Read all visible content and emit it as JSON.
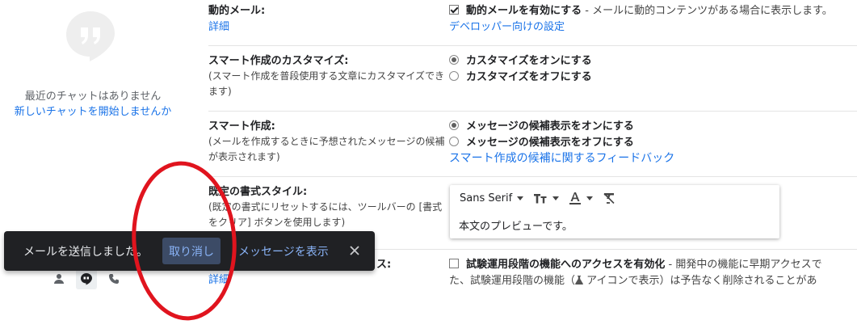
{
  "chat": {
    "empty_text": "最近のチャットはありません",
    "start_link": "新しいチャットを開始しませんか"
  },
  "settings": {
    "dynamic_mail": {
      "title": "動的メール:",
      "link": "詳細",
      "option_bold": "動的メールを有効にする",
      "option_desc": " - メールに動的コンテンツがある場合に表示します。",
      "option_link": "デベロッパー向けの設定",
      "checked": true
    },
    "smart_compose_personalize": {
      "title": "スマート作成のカスタマイズ:",
      "sub": "(スマート作成を普段使用する文章にカスタマイズできます)",
      "option_on": "カスタマイズをオンにする",
      "option_off": "カスタマイズをオフにする",
      "selected": "on"
    },
    "smart_compose": {
      "title": "スマート作成:",
      "sub": "(メールを作成するときに予想されたメッセージの候補が表示されます)",
      "option_on": "メッセージの候補表示をオンにする",
      "option_off": "メッセージの候補表示をオフにする",
      "feedback_link": "スマート作成の候補に関するフィードバック",
      "selected": "on"
    },
    "default_style": {
      "title": "既定の書式スタイル:",
      "sub": "(既定の書式にリセットするには、ツールバーの [書式をクリア] ボタンを使用します)",
      "font": "Sans Serif",
      "preview": "本文のプレビューです。"
    },
    "experimental": {
      "title_tail": "ス:",
      "link": "詳細",
      "option_bold": "試験運用段階の機能へのアクセスを有効化",
      "option_desc": " - 開発中の機能に早期アクセスで",
      "option_line2": "た、試験運用段階の機能（",
      "option_line2b": " アイコンで表示）は予告なく削除されることがあ",
      "checked": false
    }
  },
  "toast": {
    "message": "メールを送信しました。",
    "undo": "取り消し",
    "view": "メッセージを表示",
    "close_icon": "close-icon"
  },
  "colors": {
    "link": "#1a73e8",
    "toast_bg": "#202124",
    "toast_link": "#8ab4f8",
    "annotation": "#e0141e"
  }
}
